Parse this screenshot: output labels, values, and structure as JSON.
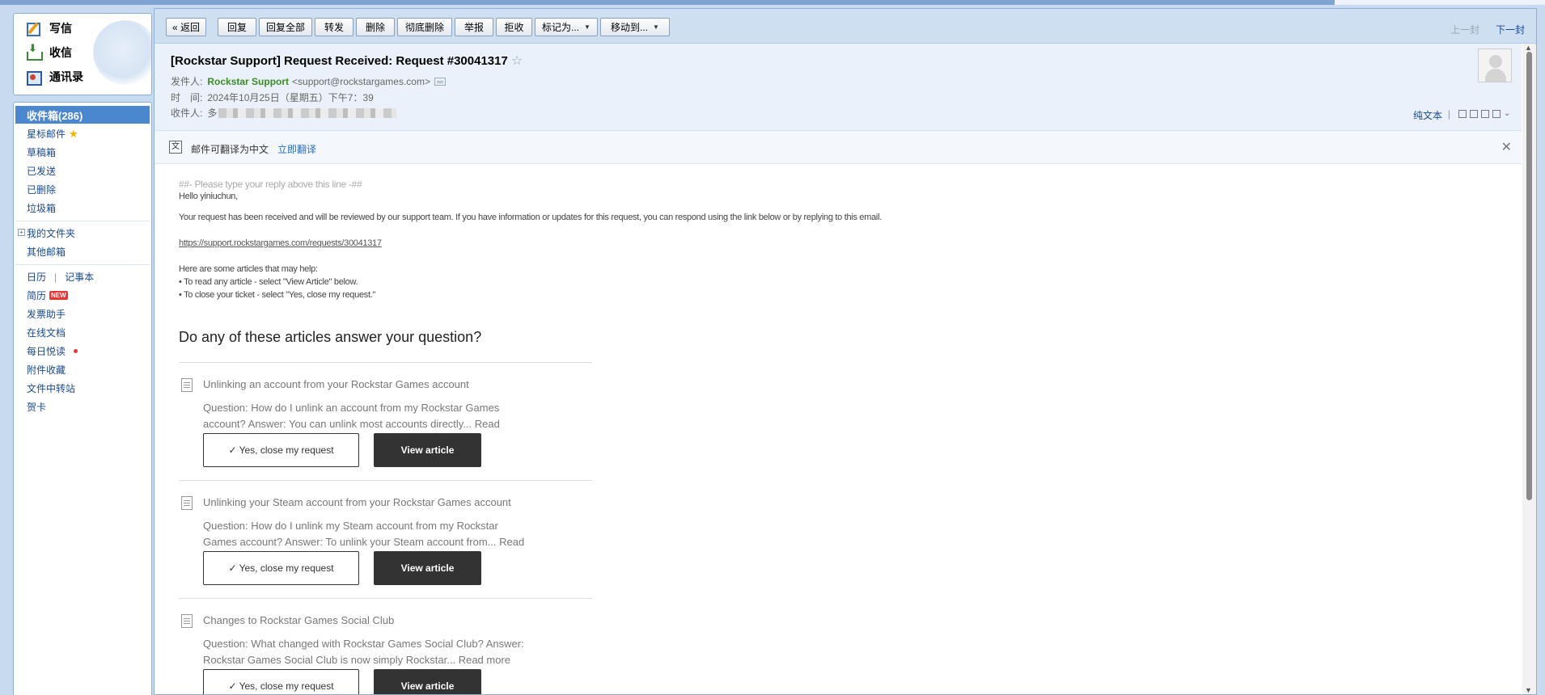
{
  "sidebar": {
    "quick": [
      {
        "label": "写信",
        "icon": "compose-icon"
      },
      {
        "label": "收信",
        "icon": "receive-icon"
      },
      {
        "label": "通讯录",
        "icon": "contacts-icon"
      }
    ],
    "inbox_label": "收件箱(286)",
    "folders": [
      "星标邮件",
      "草稿箱",
      "已发送",
      "已删除",
      "垃圾箱"
    ],
    "my_folders": "我的文件夹",
    "other_mailbox": "其他邮箱",
    "calendar": "日历",
    "notebook": "记事本",
    "resume": "简历",
    "new_badge": "NEW",
    "tools": [
      "发票助手",
      "在线文档",
      "每日悦读",
      "附件收藏",
      "文件中转站",
      "贺卡"
    ]
  },
  "toolbar": {
    "back": "« 返回",
    "reply": "回复",
    "reply_all": "回复全部",
    "forward": "转发",
    "delete": "删除",
    "delete_forever": "彻底删除",
    "report": "举报",
    "reject": "拒收",
    "mark_as": "标记为...",
    "move_to": "移动到...",
    "prev": "上一封",
    "next": "下一封"
  },
  "email": {
    "subject": "[Rockstar Support] Request Received: Request #30041317",
    "from_label": "发件人:",
    "from_name": "Rockstar Support",
    "from_addr": "<support@rockstargames.com>",
    "time_label": "时　间:",
    "time_value": "2024年10月25日（星期五）下午7：39",
    "to_label": "收件人:",
    "to_value": "多",
    "plain_text": "纯文本"
  },
  "translate": {
    "text": "邮件可翻译为中文",
    "link": "立即翻译"
  },
  "body": {
    "reply_line": "##- Please type your reply above this line -##",
    "greeting": "Hello yiniuchun,",
    "para1": "Your request has been received and will be reviewed by our support team. If you have information or updates for this request, you can respond using the link below or by replying to this email.",
    "link": "https://support.rockstargames.com/requests/30041317",
    "help_intro": "Here are some articles that may help:",
    "bullet1": "• To read any article - select \"View Article\" below.",
    "bullet2": "• To close your ticket - select \"Yes, close my request.\"",
    "articles_title": "Do any of these articles answer your question?"
  },
  "articles": [
    {
      "title": "Unlinking an account from your Rockstar Games account",
      "desc": "Question: How do I unlink an account from my Rockstar Games account? Answer: You can unlink most accounts directly... Read more",
      "close": "✓ Yes, close my request",
      "view": "View article"
    },
    {
      "title": "Unlinking your Steam account from your Rockstar Games account",
      "desc": "Question: How do I unlink my Steam account from my Rockstar Games account? Answer: To unlink your Steam account from... Read more",
      "close": "✓ Yes, close my request",
      "view": "View article"
    },
    {
      "title": "Changes to Rockstar Games Social Club",
      "desc": "Question: What changed with Rockstar Games Social Club? Answer: Rockstar Games Social Club is now simply Rockstar... Read more",
      "close": "✓ Yes, close my request",
      "view": "View article"
    }
  ],
  "colors": {
    "accent": "#4a87cf",
    "sender_green": "#3b8c26",
    "link_blue": "#2a6cbf",
    "dark_button": "#333333"
  }
}
